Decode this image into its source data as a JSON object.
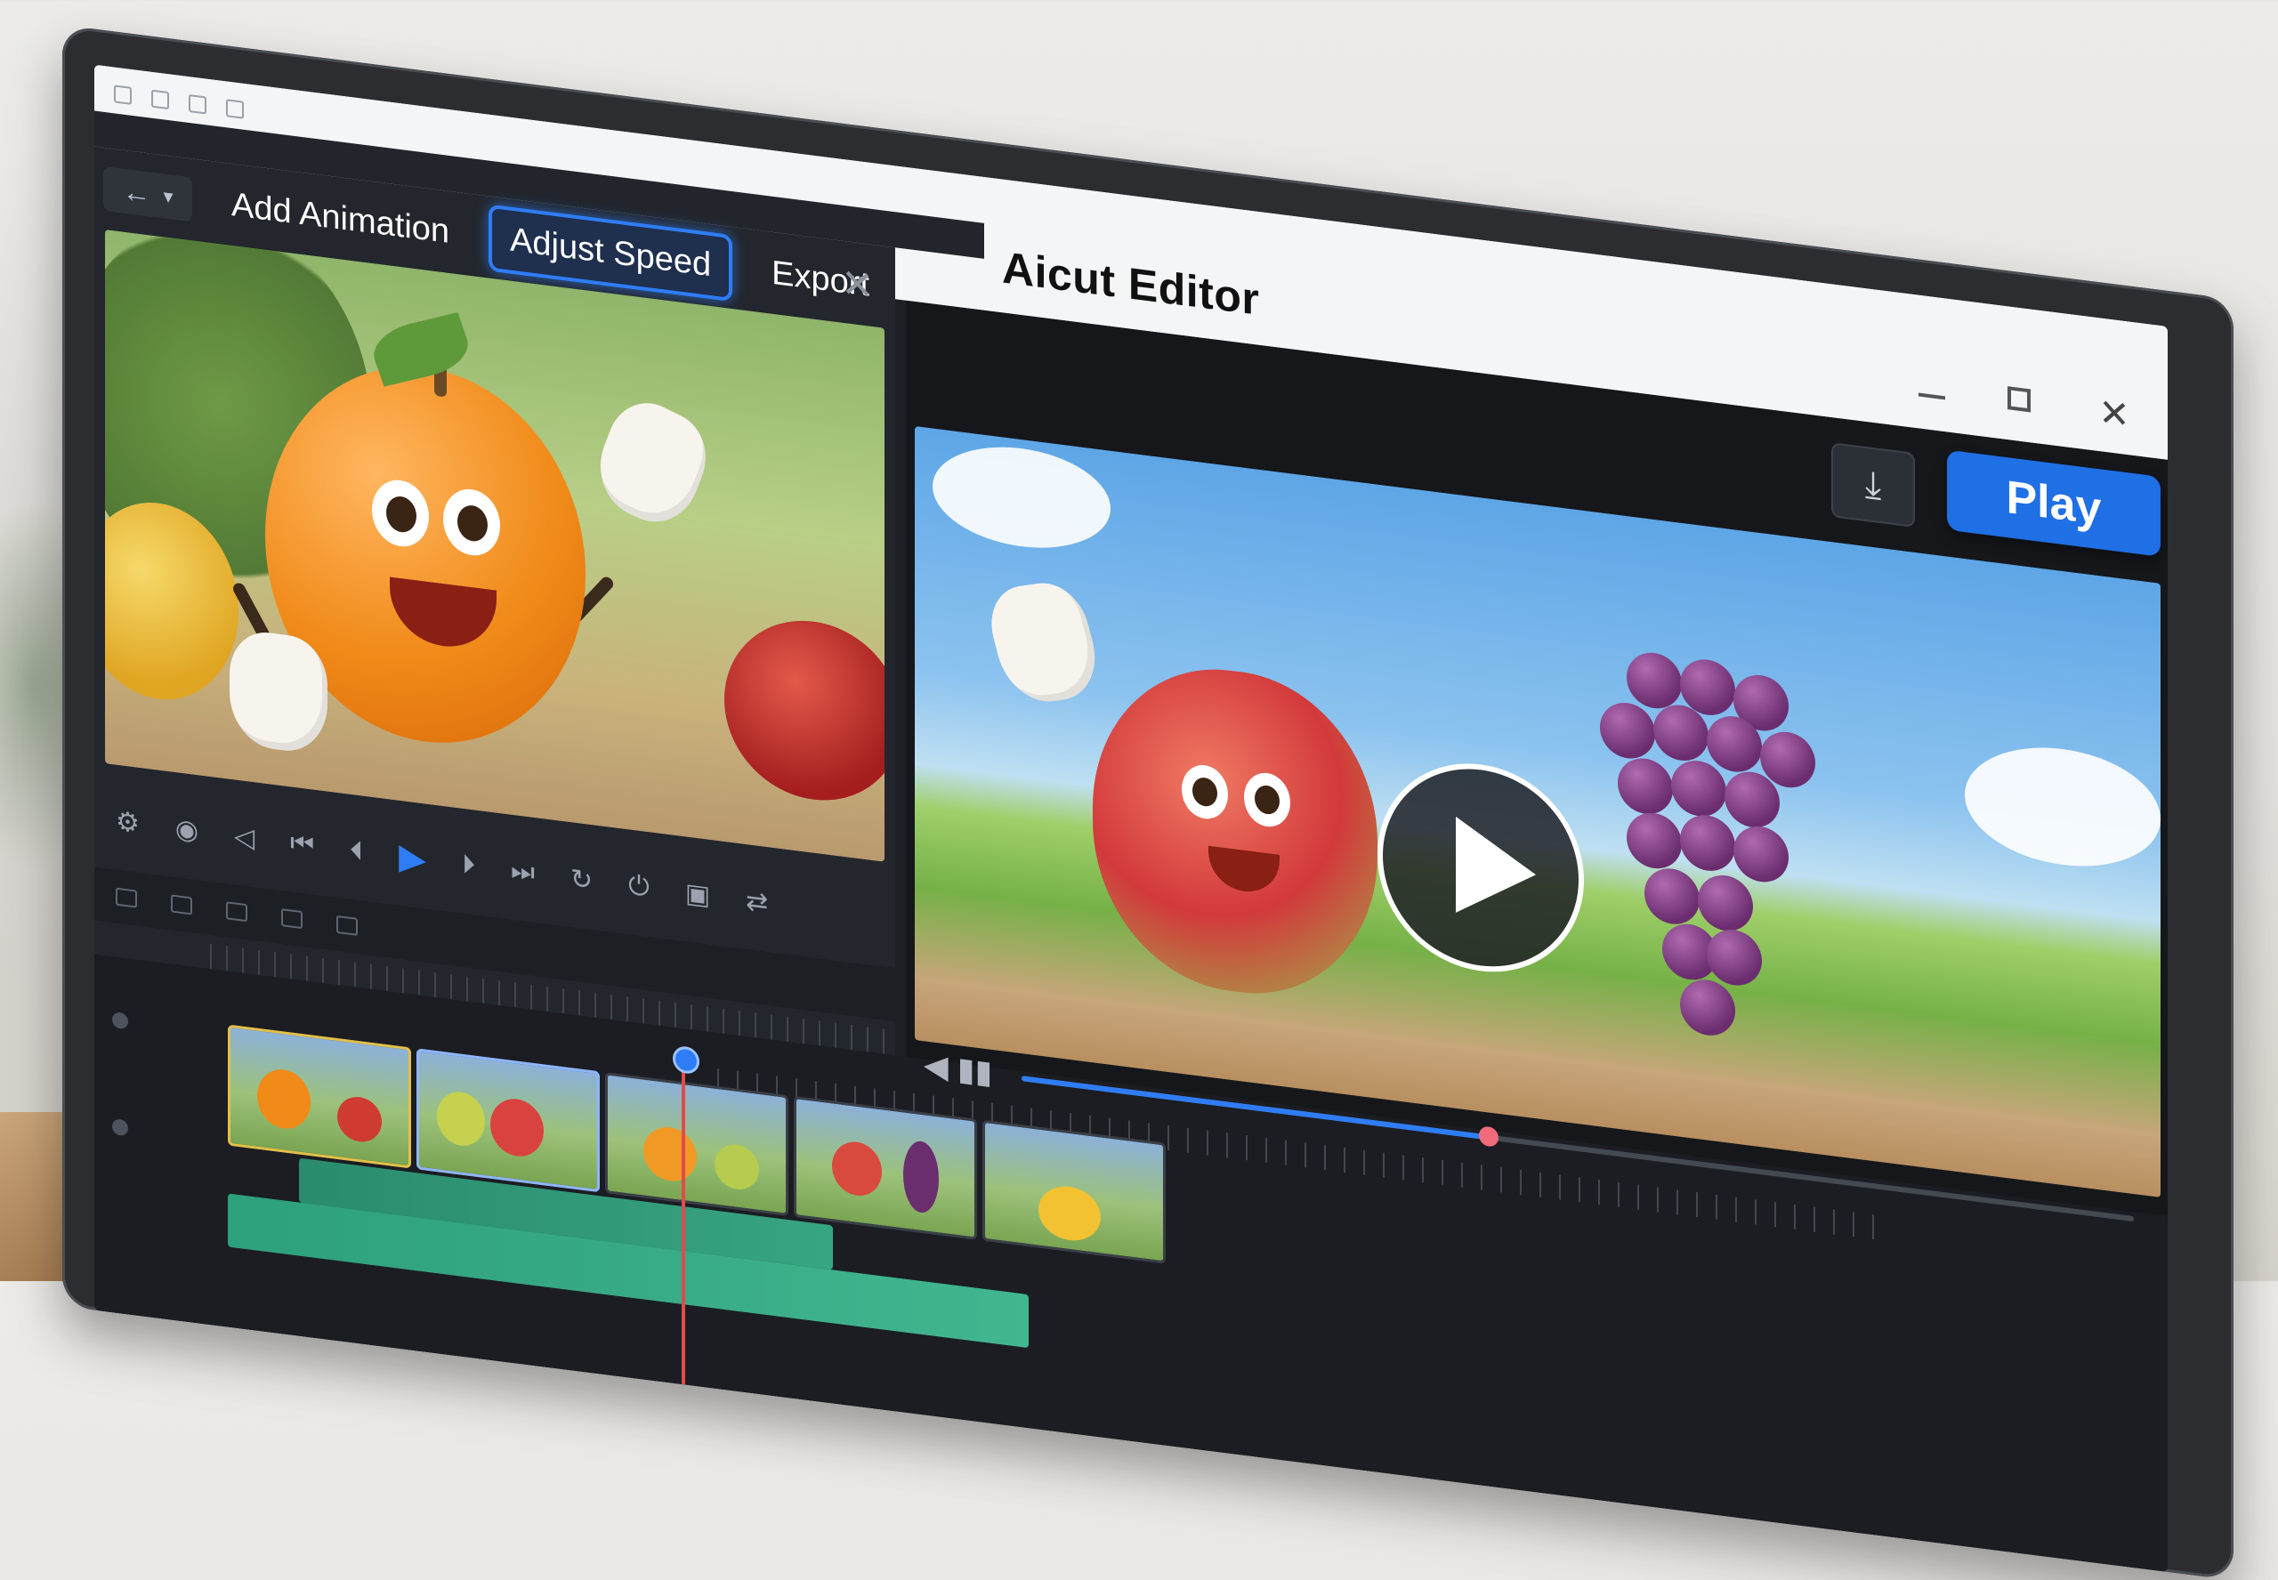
{
  "window": {
    "title": "Aicut Editor",
    "controls": [
      "minimize",
      "maximize",
      "close"
    ]
  },
  "toolbar": {
    "tabs": [
      {
        "label": "Add Animation",
        "active": false
      },
      {
        "label": "Adjust Speed",
        "active": true
      },
      {
        "label": "Export",
        "active": false
      }
    ],
    "back_icon": "arrow-left-icon",
    "close_icon": "close-icon"
  },
  "preview": {
    "play_label": "Play",
    "download_icon": "download-icon",
    "progress": 0.42
  },
  "transport": {
    "icons": [
      "settings-icon",
      "marker-icon",
      "prev-frame-icon",
      "skip-start-icon",
      "step-back-icon",
      "play-icon",
      "step-forward-icon",
      "skip-end-icon",
      "rotate-icon",
      "power-icon"
    ]
  },
  "colors": {
    "accent": "#2f7df6",
    "play_button": "#1f6fe5",
    "playhead": "#e14b4b",
    "audio_track": "#3cbc93"
  }
}
